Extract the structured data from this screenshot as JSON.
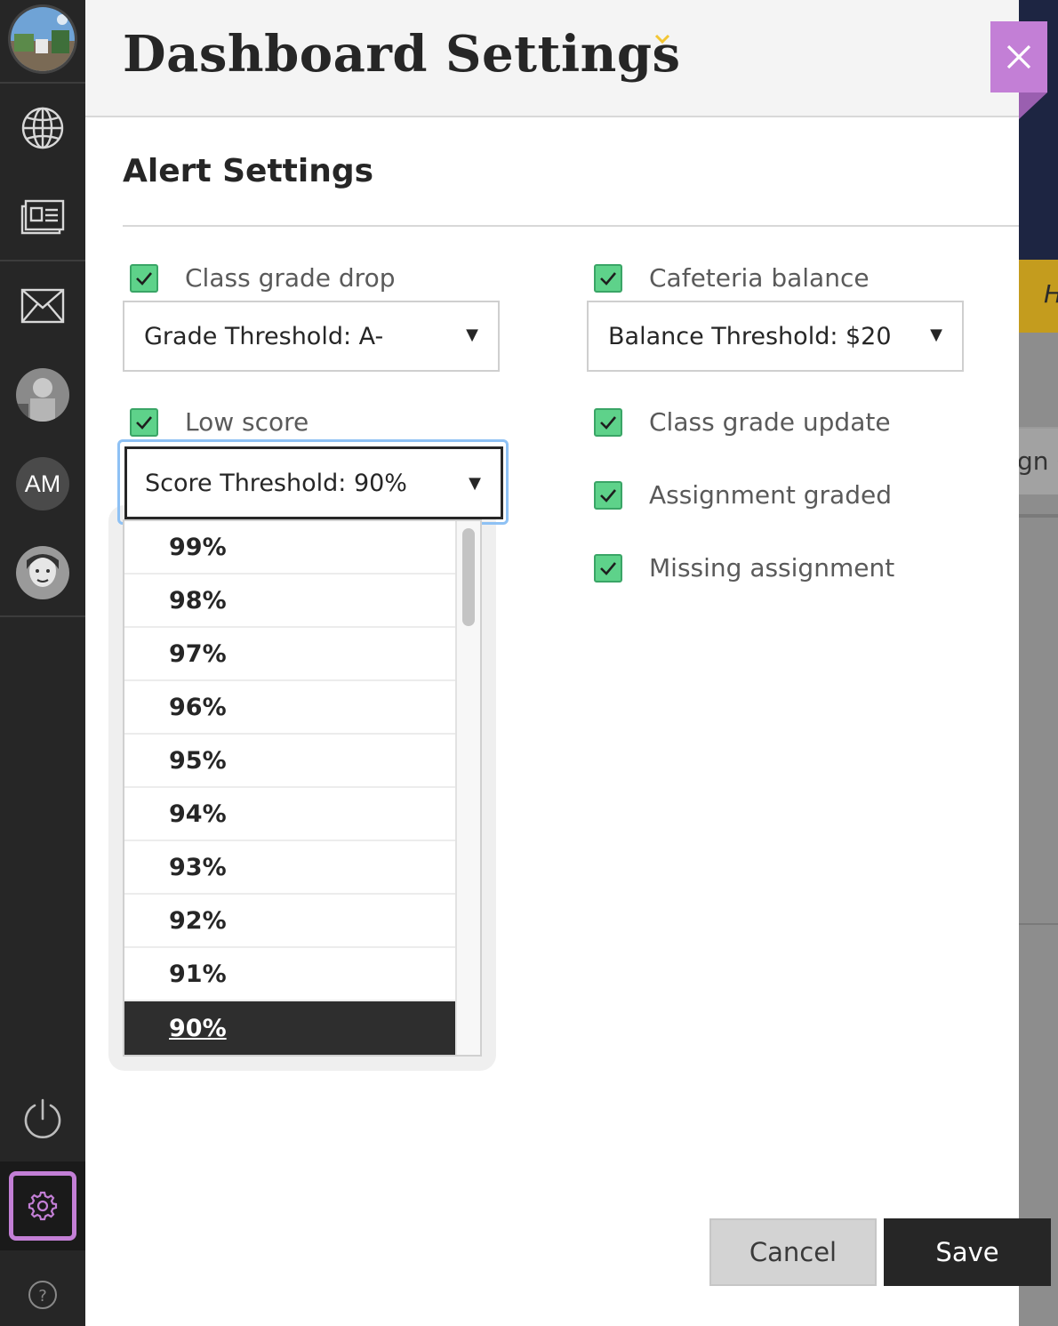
{
  "panel": {
    "title": "Dashboard Settings",
    "section_title": "Alert Settings"
  },
  "rail": {
    "user_initials": "AM"
  },
  "alerts": {
    "class_grade_drop": {
      "label": "Class grade drop",
      "checked": true,
      "select_value": "Grade Threshold: A-"
    },
    "low_score": {
      "label": "Low score",
      "checked": true,
      "select_value": "Score Threshold: 90%"
    },
    "cafeteria_balance": {
      "label": "Cafeteria balance",
      "checked": true,
      "select_value": "Balance Threshold: $20"
    },
    "class_grade_update": {
      "label": "Class grade update",
      "checked": true
    },
    "assignment_graded": {
      "label": "Assignment graded",
      "checked": true
    },
    "missing_assignment": {
      "label": "Missing assignment",
      "checked": true
    }
  },
  "score_options": [
    "99%",
    "98%",
    "97%",
    "96%",
    "95%",
    "94%",
    "93%",
    "92%",
    "91%",
    "90%"
  ],
  "score_selected": "90%",
  "select_arrow": "▼",
  "buttons": {
    "cancel": "Cancel",
    "save": "Save"
  },
  "background": {
    "yellow_text": "H",
    "button_text": "gn C"
  },
  "colors": {
    "accent": "#c37fd6",
    "checkbox": "#5ed28a",
    "focus": "#8ec1f4",
    "header_chevron": "#f3c633"
  }
}
